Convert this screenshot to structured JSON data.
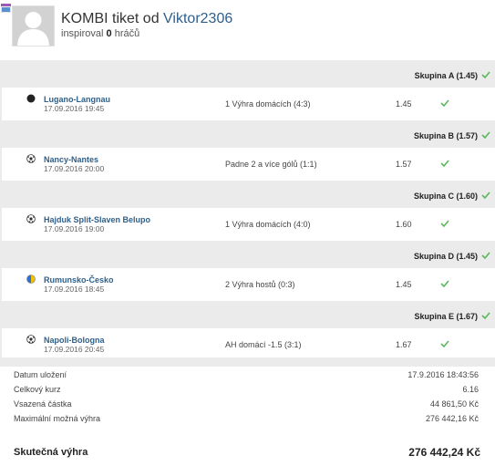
{
  "header": {
    "title_prefix": "KOMBI tiket od",
    "username": "Viktor2306",
    "subtitle_prefix": "inspiroval",
    "inspired_count": "0",
    "subtitle_suffix": "hráčů"
  },
  "groups": [
    {
      "label": "Skupina A (1.45)",
      "teams": "Lugano-Langnau",
      "date": "17.09.2016 19:45",
      "bet": "1 Výhra domácích (4:3)",
      "odd": "1.45",
      "sport_icon": "hockey-puck-icon"
    },
    {
      "label": "Skupina B (1.57)",
      "teams": "Nancy-Nantes",
      "date": "17.09.2016 20:00",
      "bet": "Padne 2 a více gólů (1:1)",
      "odd": "1.57",
      "sport_icon": "soccer-ball-icon"
    },
    {
      "label": "Skupina C (1.60)",
      "teams": "Hajduk Split-Slaven Belupo",
      "date": "17.09.2016 19:00",
      "bet": "1 Výhra domácích (4:0)",
      "odd": "1.60",
      "sport_icon": "soccer-ball-icon"
    },
    {
      "label": "Skupina D (1.45)",
      "teams": "Rumunsko-Česko",
      "date": "17.09.2016 18:45",
      "bet": "2 Výhra hostů (0:3)",
      "odd": "1.45",
      "sport_icon": "volleyball-icon"
    },
    {
      "label": "Skupina E (1.67)",
      "teams": "Napoli-Bologna",
      "date": "17.09.2016 20:45",
      "bet": "AH domácí -1.5 (3:1)",
      "odd": "1.67",
      "sport_icon": "soccer-ball-icon"
    }
  ],
  "summary": [
    {
      "key": "Datum uložení",
      "value": "17.9.2016 18:43:56"
    },
    {
      "key": "Celkový kurz",
      "value": "6.16"
    },
    {
      "key": "Vsazená částka",
      "value": "44 861,50 Kč"
    },
    {
      "key": "Maximální možná výhra",
      "value": "276 442,16 Kč"
    }
  ],
  "final": {
    "key": "Skutečná výhra",
    "value": "276 442,24 Kč"
  },
  "colors": {
    "link": "#2d5f8b",
    "check": "#5cb85c",
    "band": "#ebebeb"
  }
}
